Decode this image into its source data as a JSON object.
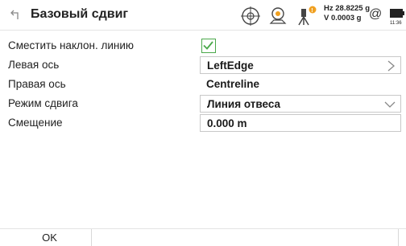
{
  "header": {
    "title": "Базовый сдвиг",
    "hz": "Hz 28.8225 g",
    "v": "V  0.0003 g",
    "at_symbol": "@",
    "clock": "11:36"
  },
  "form": {
    "rows": [
      {
        "label": "Сместить наклон. линию",
        "type": "checkbox",
        "checked": true
      },
      {
        "label": "Левая ось",
        "type": "select-arrow",
        "value": "LeftEdge"
      },
      {
        "label": "Правая ось",
        "type": "static",
        "value": "Centreline"
      },
      {
        "label": "Режим сдвига",
        "type": "dropdown",
        "value": "Линия отвеса"
      },
      {
        "label": "Смещение",
        "type": "input",
        "value": "0.000 m"
      }
    ]
  },
  "footer": {
    "ok_label": "OK"
  },
  "colors": {
    "check_green": "#4aa84a",
    "tilt_badge": "#f0a020",
    "border": "#c8c8c8"
  },
  "icons": [
    "back-icon",
    "target-icon",
    "prism-icon",
    "tilt-instrument-icon",
    "at-icon",
    "battery-icon",
    "chevron-right-icon",
    "chevron-down-icon",
    "checkmark-icon"
  ]
}
